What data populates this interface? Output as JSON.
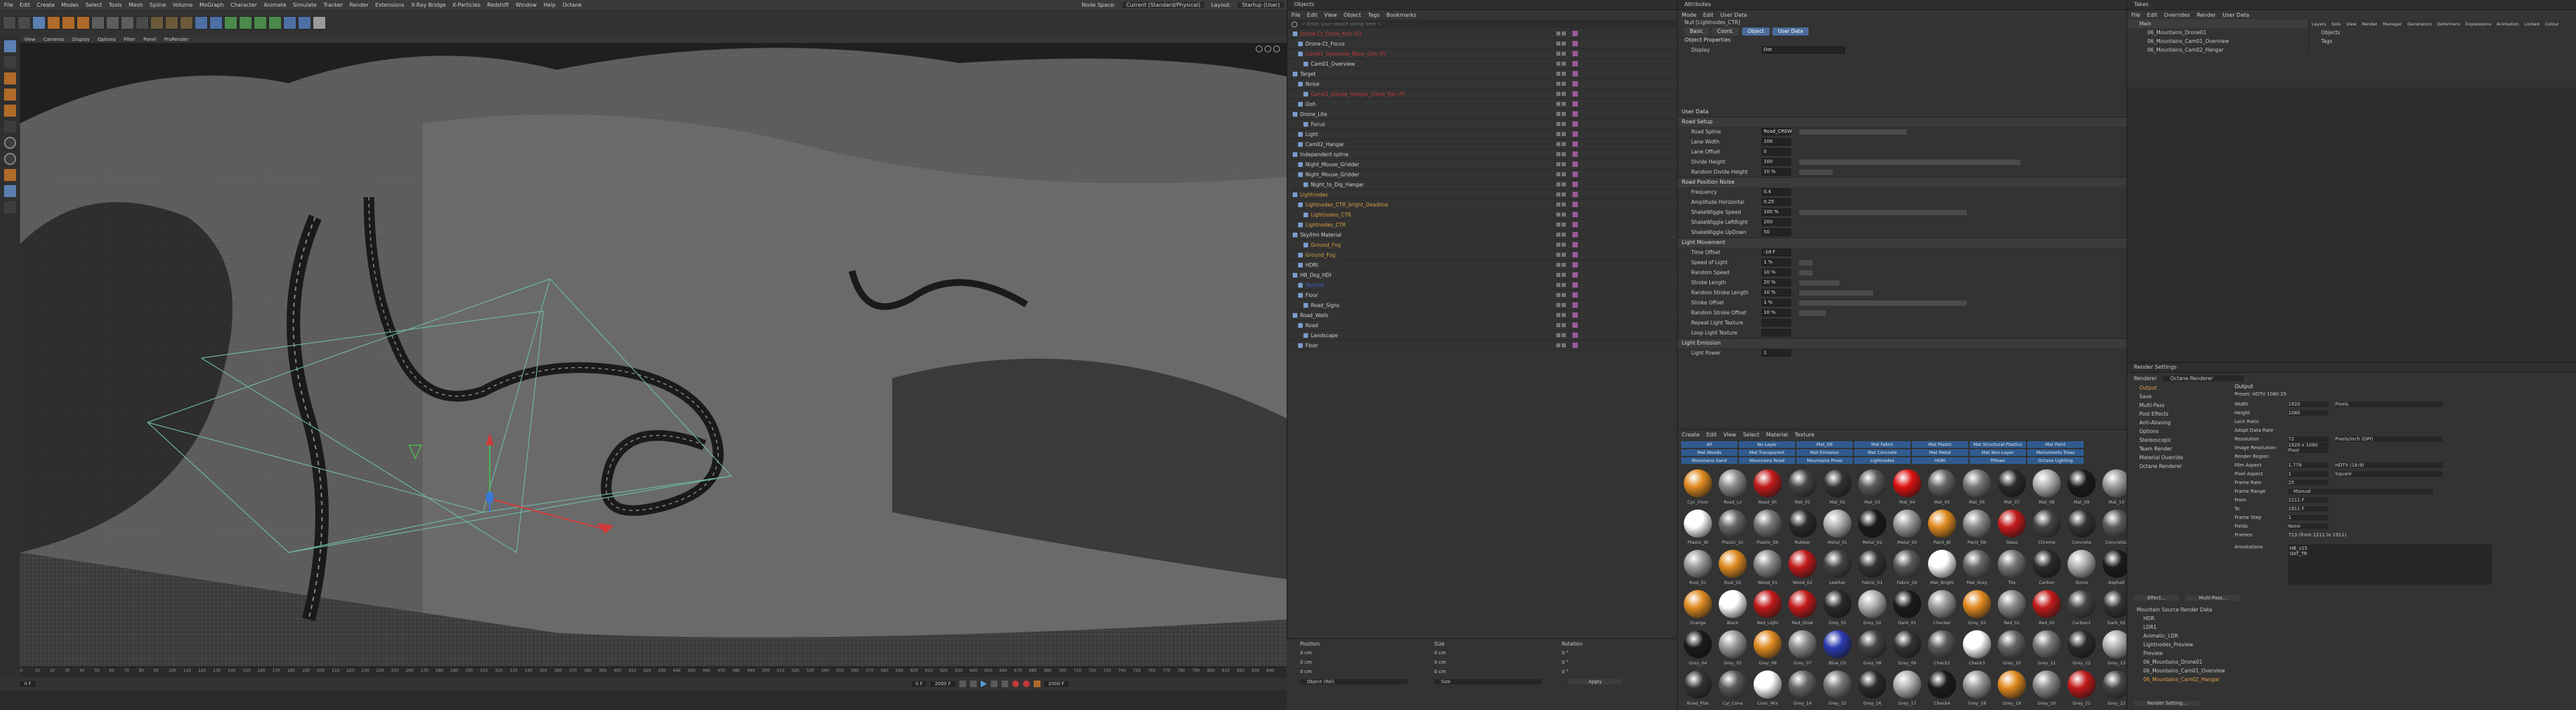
{
  "app": {
    "menu": [
      "File",
      "Edit",
      "Create",
      "Modes",
      "Select",
      "Tools",
      "Mesh",
      "Spline",
      "Volume",
      "MoGraph",
      "Character",
      "Animate",
      "Simulate",
      "Tracker",
      "Render",
      "Extensions",
      "X-Ray Bridge",
      "X-Particles",
      "Redshift",
      "Window",
      "Help",
      "Octane"
    ],
    "node_space_label": "Node Space:",
    "node_space_value": "Current (Standard/Physical)",
    "layout_label": "Layout:",
    "layout_value": "Startup (User)"
  },
  "viewport": {
    "menu": [
      "View",
      "Cameras",
      "Display",
      "Options",
      "Filter",
      "Panel",
      "ProRender"
    ],
    "timeline_ticks": [
      "0",
      "10",
      "20",
      "30",
      "40",
      "50",
      "60",
      "70",
      "80",
      "90",
      "100",
      "110",
      "120",
      "130",
      "140",
      "150",
      "160",
      "170",
      "180",
      "190",
      "200",
      "210",
      "220",
      "230",
      "240",
      "250",
      "260",
      "270",
      "280",
      "290",
      "300",
      "310",
      "320",
      "330",
      "340",
      "350",
      "360",
      "370",
      "380",
      "390",
      "400",
      "410",
      "420",
      "430",
      "440",
      "450",
      "460",
      "470",
      "480",
      "490",
      "500",
      "510",
      "520",
      "530",
      "540",
      "550",
      "560",
      "570",
      "580",
      "590",
      "600",
      "610",
      "620",
      "630",
      "640",
      "650",
      "660",
      "670",
      "680",
      "690",
      "700",
      "710",
      "720",
      "730",
      "740",
      "750",
      "760",
      "770",
      "780",
      "790",
      "800",
      "810",
      "820",
      "830",
      "840"
    ],
    "current_frame": "0 F",
    "frame_start": "0 F",
    "frame_end": "2000 F",
    "frame_end2": "2000 F"
  },
  "objects": {
    "title": "Objects",
    "menu": [
      "File",
      "Edit",
      "View",
      "Object",
      "Tags",
      "Bookmarks"
    ],
    "search_placeholder": "< Enter your search string here >",
    "items": [
      "Drone-Ct_Clone_Anit (G)",
      "Drone-Ct_Focus",
      "Cam01_Overview_Bbox_Ooh (P)",
      "Cam01_Overview",
      "Target",
      "Noise",
      "Cam01_Daybe_Hangar_Clone_Pan (P)",
      "Ooh",
      "Drone_Lite",
      "Focus",
      "Light",
      "Cam02_Hangar",
      "Independent spline",
      "Night_Mouse_Gridder",
      "Night_Mouse_Gridder",
      "Night_to_Dig_Hangar",
      "Lightnodes",
      "Lightnodes_CTR_bright_Deadline",
      "Lightnodes_CTR",
      "Lightnodes_CTR",
      "Sky/Hm Material",
      "Ground_Fog",
      "Ground_Fog",
      "HDRI",
      "HB_Dsg_HDI",
      "Texture",
      "Floor",
      "Road_Signs",
      "Road_Walls",
      "Road",
      "Landscape",
      "Floor"
    ],
    "coords_headers": [
      "Position",
      "Size",
      "Rotation"
    ],
    "coords": {
      "x": [
        "0 cm",
        "0 cm",
        "0 °"
      ],
      "y": [
        "0 cm",
        "0 cm",
        "0 °"
      ],
      "z": [
        "0 cm",
        "0 cm",
        "0 °"
      ]
    },
    "coord_mode": "Object (Rel)",
    "size_mode": "Size",
    "apply_label": "Apply"
  },
  "attributes": {
    "title": "Attributes",
    "menu": [
      "Mode",
      "Edit",
      "User Data"
    ],
    "object_name": "Null [Lightnodes_CTR]",
    "tabs": [
      "Basic",
      "Coord.",
      "Object",
      "User Data"
    ],
    "section_object": "Object Properties",
    "display_label": "Display",
    "display_value": "Dot",
    "user_data_heading": "User Data",
    "group1": "Road Setup",
    "group1_rows": [
      {
        "label": "Road Spline",
        "value": "Road_CREW"
      },
      {
        "label": "Lane Width",
        "value": "100"
      },
      {
        "label": "Lane Offset",
        "value": "0"
      },
      {
        "label": "Divide Height",
        "value": "100"
      },
      {
        "label": "Random Divide Height",
        "value": "10 %"
      }
    ],
    "group2": "Road Position Noise",
    "group2_rows": [
      {
        "label": "Frequency",
        "value": "0.4"
      },
      {
        "label": "Amplitude Horizontal",
        "value": "0.25"
      },
      {
        "label": "ShakeWiggle Speed",
        "value": "100 %"
      },
      {
        "label": "ShakeWiggle LeftRight",
        "value": "200"
      },
      {
        "label": "ShakeWiggle UpDown",
        "value": "50"
      }
    ],
    "group3": "Light Movement",
    "group3_rows": [
      {
        "label": "Time Offset",
        "value": "-18 F"
      },
      {
        "label": "Speed of Light",
        "value": "1 %"
      },
      {
        "label": "Random Speed",
        "value": "10 %"
      },
      {
        "label": "Stroke Length",
        "value": "20 %"
      },
      {
        "label": "Random Stroke Length",
        "value": "10 %"
      },
      {
        "label": "Stroke Offset",
        "value": "1 %"
      },
      {
        "label": "Random Stroke Offset",
        "value": "10 %"
      },
      {
        "label": "Repeat Light Texture",
        "value": ""
      },
      {
        "label": "Loop Light Texture",
        "value": ""
      }
    ],
    "group4": "Light Emission",
    "group4_rows": [
      {
        "label": "Light Power",
        "value": "1"
      }
    ]
  },
  "materials": {
    "menu": [
      "Create",
      "Edit",
      "View",
      "Select",
      "Material",
      "Texture"
    ],
    "layer_buttons": [
      "All",
      "No Layer",
      "Mat_DE",
      "Mat Fabric",
      "Mat Plastic",
      "Mat Structural Plastics",
      "Mat Paint",
      "Mat Woods",
      "Mat Transparent",
      "Mat Emission",
      "Mat Concrete",
      "Mat Metal",
      "Mat Non-Layer",
      "Monuments Trees",
      "Mountains Sand",
      "Mountains Road",
      "Mountains Pines",
      "Lightnodes",
      "HDRI",
      "Pillows",
      "Octane Lighting"
    ],
    "rows": [
      [
        "Cyc_Floor",
        "Road_Ln",
        "Road_Sh",
        "Mat_01",
        "Mat_02",
        "Mat_03",
        "Mat_04",
        "Mat_05",
        "Mat_06",
        "Mat_07",
        "Mat_08",
        "Mat_09",
        "Mat_10"
      ],
      [
        "Plastic_Bl",
        "Plastic_Gr",
        "Plastic_Dk",
        "Rubber",
        "Metal_01",
        "Metal_02",
        "Metal_03",
        "Paint_Bl",
        "Paint_Dk",
        "Glass",
        "Chrome",
        "Concrete",
        "Concrete2"
      ],
      [
        "Rust_01",
        "Rust_02",
        "Wood_01",
        "Wood_02",
        "Leather",
        "Fabric_01",
        "Fabric_02",
        "Mat_Bright",
        "Mat_Grey",
        "Tile",
        "Carbon",
        "Stone",
        "Asphalt"
      ],
      [
        "Orange",
        "Black",
        "Red_Light",
        "Red_Glow",
        "Grey_01",
        "Grey_02",
        "Dark_01",
        "Checker",
        "Grey_03",
        "Red_01",
        "Red_02",
        "Carbon2",
        "Dark_02"
      ],
      [
        "Grey_04",
        "Grey_05",
        "Grey_06",
        "Grey_07",
        "Blue_Ch",
        "Grey_08",
        "Grey_09",
        "Check2",
        "Check3",
        "Grey_10",
        "Grey_11",
        "Grey_12",
        "Grey_13"
      ],
      [
        "Road_Plas",
        "Cyl_Cone",
        "Conc_Mix",
        "Grey_14",
        "Grey_15",
        "Grey_16",
        "Grey_17",
        "Check4",
        "Grey_18",
        "Grey_19",
        "Grey_20",
        "Grey_21",
        "Grey_22"
      ]
    ]
  },
  "takes": {
    "title": "Takes",
    "menu": [
      "File",
      "Edit",
      "Overrides",
      "Render",
      "User Data"
    ],
    "header": "Main",
    "items": [
      "06_Mountains_Drone01",
      "06_Mountains_Cam01_Overview",
      "06_Mountains_Cam02_Hangar"
    ],
    "layer_headers": [
      "Layers",
      "Solo",
      "View",
      "Render",
      "Manager",
      "Generators",
      "Deformers",
      "Expressions",
      "Animation",
      "Locked",
      "Colour"
    ],
    "layer_items": [
      "Objects",
      "Tags"
    ]
  },
  "render_settings": {
    "title": "Render Settings",
    "renderer_label": "Renderer",
    "renderer_value": "Octane Renderer",
    "left_items": [
      "Output",
      "Save",
      "Multi-Pass",
      "Post Effects",
      "Anti-Aliasing",
      "Options",
      "Stereoscopic",
      "Team Render",
      "Material Override",
      "Octane Renderer"
    ],
    "output_heading": "Output",
    "preset_label": "Preset: HDTV 1080 25",
    "fields": [
      {
        "label": "Width",
        "value": "1920",
        "unit": "Pixels"
      },
      {
        "label": "Height",
        "value": "1080",
        "unit": ""
      },
      {
        "label": "Lock Ratio",
        "value": "",
        "unit": ""
      },
      {
        "label": "Adapt Data Rate",
        "value": "",
        "unit": ""
      },
      {
        "label": "Resolution",
        "value": "72",
        "unit": "Pixels/Inch (DPI)"
      },
      {
        "label": "Image Resolution:",
        "value": "1920 x 1080 Pixel",
        "unit": ""
      },
      {
        "label": "Render Region",
        "value": "",
        "unit": ""
      },
      {
        "label": "Film Aspect",
        "value": "1.778",
        "unit": "HDTV (16:9)"
      },
      {
        "label": "Pixel Aspect",
        "value": "1",
        "unit": "Square"
      },
      {
        "label": "Frame Rate",
        "value": "25",
        "unit": ""
      }
    ],
    "frame_range_label": "Frame Range",
    "frame_range_value": "Manual",
    "frame_fields": [
      {
        "label": "From",
        "value": "1211 F"
      },
      {
        "label": "To",
        "value": "1911 F"
      },
      {
        "label": "Frame Step",
        "value": "1"
      },
      {
        "label": "Fields",
        "value": "None"
      }
    ],
    "frames_label": "Frames:",
    "frames_value": "713 (from 1211 to 1911)",
    "annotations_label": "Annotations",
    "annotation_text": "HB_v15\nOAT_TR",
    "effect_button": "Effect...",
    "multipass_button": "Multi-Pass...",
    "render_setting_button": "Render Setting...",
    "list": [
      "Mountain Source Render Data",
      "HDR",
      "LDR1",
      "Animatic_LDR",
      "Lightnodes_Preview",
      "Preview",
      "06_Mountains_Drone01",
      "06_Mountains_Cam01_Overview",
      "06_Mountains_Cam02_Hangar"
    ]
  }
}
